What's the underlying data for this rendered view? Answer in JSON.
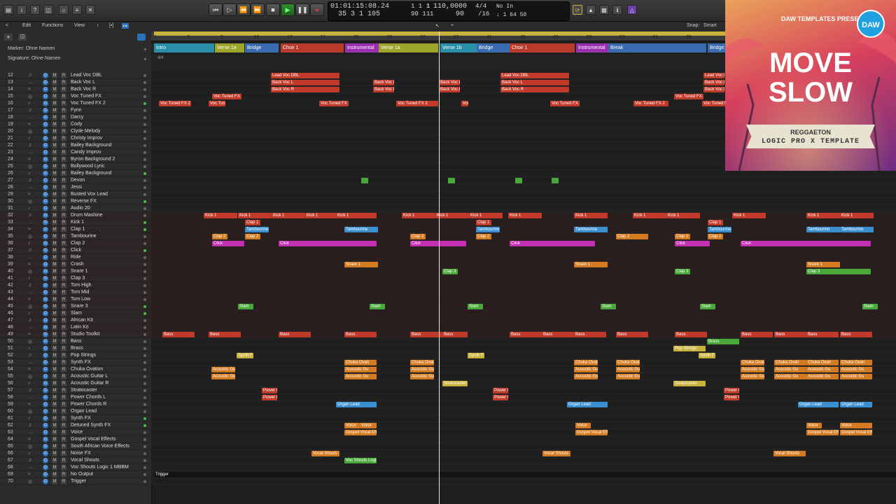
{
  "controlbar": {
    "position_time": "01:01:15:08.24",
    "position_bars": "35  3  1  105",
    "end_time": "1  1  1",
    "end_bars": "90  1  1",
    "cycle_a": "1",
    "cycle_b": "1",
    "tempo": "110,0000",
    "tempo2": "90",
    "signature": "4/4",
    "division": "/16",
    "input": "No In",
    "cpu": "↓ 1  64  50"
  },
  "toolbar": {
    "edit": "Edit",
    "functions": "Functions",
    "view": "View",
    "snap_label": "Snap:",
    "snap_value": "Smart"
  },
  "global": {
    "marker": "Marker: Ohne Namen",
    "signature": "Signature: Ohne Namen"
  },
  "ruler": [
    "1",
    "5",
    "9",
    "13",
    "17",
    "21",
    "25",
    "29",
    "33",
    "37",
    "41",
    "45",
    "49",
    "53",
    "57",
    "61",
    "65"
  ],
  "markers": [
    {
      "label": "Intro",
      "color": "#2a8fa8"
    },
    {
      "label": "Verse 1a",
      "color": "#9da62a"
    },
    {
      "label": "Bridge",
      "color": "#3a6bb0"
    },
    {
      "label": "Choir 1",
      "color": "#b83a2a"
    },
    {
      "label": "Instrumental",
      "color": "#9a2fb0"
    },
    {
      "label": "Verse 1a",
      "color": "#9da62a"
    },
    {
      "label": "Verse 1b",
      "color": "#2a8fa8"
    },
    {
      "label": "Bridge",
      "color": "#3a6bb0"
    },
    {
      "label": "Choir 1",
      "color": "#b83a2a"
    },
    {
      "label": "Instrumental",
      "color": "#9a2fb0"
    },
    {
      "label": "Break",
      "color": "#3a6bb0"
    },
    {
      "label": "Bridge",
      "color": "#3a6bb0"
    }
  ],
  "tracks": [
    {
      "n": "12",
      "name": "Lead Voc DBL"
    },
    {
      "n": "13",
      "name": "Back Voc L"
    },
    {
      "n": "14",
      "name": "Back Voc R"
    },
    {
      "n": "15",
      "name": "Voc Tuned FX"
    },
    {
      "n": "16",
      "name": "Voc Tuned FX 2"
    },
    {
      "n": "17",
      "name": "Fynn"
    },
    {
      "n": "18",
      "name": "Darcy"
    },
    {
      "n": "19",
      "name": "Cody"
    },
    {
      "n": "20",
      "name": "Clyde Melody"
    },
    {
      "n": "21",
      "name": "Christy Improv"
    },
    {
      "n": "22",
      "name": "Bailey Background"
    },
    {
      "n": "23",
      "name": "Candy Improv"
    },
    {
      "n": "24",
      "name": "Byron Background 2"
    },
    {
      "n": "25",
      "name": "Bollywood Lyric"
    },
    {
      "n": "26",
      "name": "Bailey Background"
    },
    {
      "n": "27",
      "name": "Devon"
    },
    {
      "n": "28",
      "name": "Jessi"
    },
    {
      "n": "29",
      "name": "Busted Vox Lead"
    },
    {
      "n": "30",
      "name": "Reverse FX"
    },
    {
      "n": "31",
      "name": "Audio 20"
    },
    {
      "n": "32",
      "name": "Drum Mashine"
    },
    {
      "n": "33",
      "name": "Kick 1"
    },
    {
      "n": "34",
      "name": "Clap 1"
    },
    {
      "n": "35",
      "name": "Tambourine"
    },
    {
      "n": "36",
      "name": "Clap 2"
    },
    {
      "n": "37",
      "name": "Click"
    },
    {
      "n": "38",
      "name": "Ride"
    },
    {
      "n": "39",
      "name": "Crash"
    },
    {
      "n": "40",
      "name": "Snare 1"
    },
    {
      "n": "41",
      "name": "Clap 3"
    },
    {
      "n": "42",
      "name": "Tom High"
    },
    {
      "n": "43",
      "name": "Tom Mid"
    },
    {
      "n": "44",
      "name": "Tom Low"
    },
    {
      "n": "45",
      "name": "Snare 3"
    },
    {
      "n": "46",
      "name": "Slam"
    },
    {
      "n": "47",
      "name": "African Kit"
    },
    {
      "n": "48",
      "name": "Latin Kit"
    },
    {
      "n": "49",
      "name": "Studio Toolkit"
    },
    {
      "n": "50",
      "name": "Bass"
    },
    {
      "n": "51",
      "name": "Brass"
    },
    {
      "n": "52",
      "name": "Pop Strings"
    },
    {
      "n": "53",
      "name": "Synth FX"
    },
    {
      "n": "54",
      "name": "Chuka Ovation"
    },
    {
      "n": "55",
      "name": "Acoustic Guitar L"
    },
    {
      "n": "56",
      "name": "Acoustic Guitar R"
    },
    {
      "n": "57",
      "name": "Stratocaster"
    },
    {
      "n": "58",
      "name": "Power Chords L"
    },
    {
      "n": "59",
      "name": "Power Chords R"
    },
    {
      "n": "60",
      "name": "Organ Lead"
    },
    {
      "n": "61",
      "name": "Synth FX"
    },
    {
      "n": "62",
      "name": "Detuned Synth FX"
    },
    {
      "n": "63",
      "name": "Voice"
    },
    {
      "n": "64",
      "name": "Gospel Vocal Effects"
    },
    {
      "n": "65",
      "name": "South African Voice Effects"
    },
    {
      "n": "66",
      "name": "Noise FX"
    },
    {
      "n": "67",
      "name": "Vocal Shouts"
    },
    {
      "n": "68",
      "name": "Voc Shouts Logic 1 MBBM"
    },
    {
      "n": "69",
      "name": "No Output"
    },
    {
      "n": "70",
      "name": "Trigger"
    }
  ],
  "region_labels": {
    "lead_dbl": "Lead Voc DBL",
    "back_l": "Back Voc L",
    "back_r": "Back Voc R",
    "voc_fx": "Voc Tuned FX",
    "voc_fx2": "Voc Tuned FX 2",
    "kick": "Kick 1",
    "clap1": "Clap 1",
    "tamb": "Tambourine",
    "clap2": "Clap 2",
    "click": "Click",
    "snare1": "Snare 1",
    "clap3": "Clap 3",
    "slam": "Slam",
    "bass": "Bass",
    "brass": "Brass",
    "pop": "Pop Strings",
    "synthfx": "Synth F",
    "chuka": "Chuka Ovati",
    "acou": "Acoustic Gu",
    "strat": "Stratocaster",
    "power": "Power C",
    "organ": "Organ Lead",
    "voice": "Voice",
    "gospel": "Gospel Vocal Eff",
    "shouts": "Vocal Shouts",
    "shouts2": "Voc Shouts Logi",
    "reverse": "Reverse FX",
    "drum": "Drum Mashine",
    "trigger": "Trigger"
  },
  "promo": {
    "brand": "DAW TEMPLATES PRESENTS",
    "logo": "DAW",
    "title1": "MOVE",
    "title2": "SLOW",
    "genre": "REGGAETON",
    "product": "LOGIC PRO X TEMPLATE"
  },
  "colors": {
    "red": "#c23a2a",
    "orange": "#d47a20",
    "yellow": "#c9b23b",
    "green": "#4aa83a",
    "teal": "#2aa88a",
    "blue": "#3a8fd0",
    "purple": "#a82fb8",
    "magenta": "#c22fb0"
  }
}
